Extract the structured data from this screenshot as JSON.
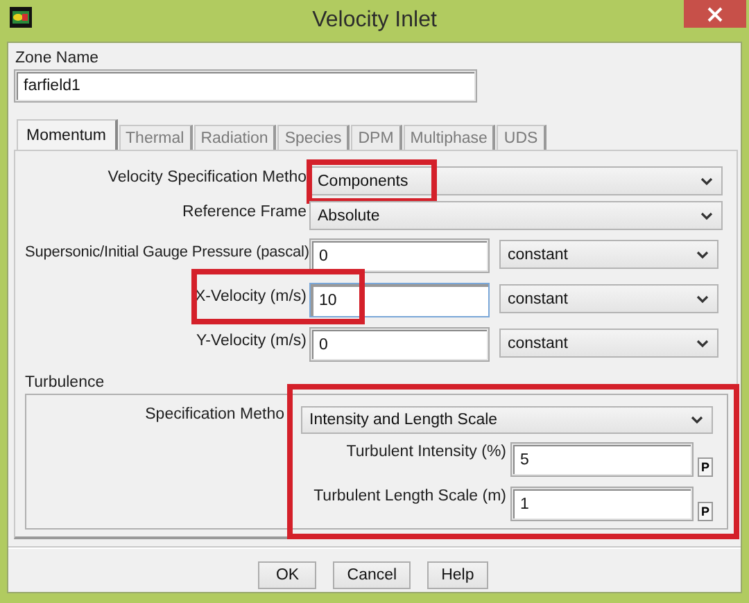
{
  "window": {
    "title": "Velocity Inlet"
  },
  "zone_name": {
    "label": "Zone Name",
    "value": "farfield1"
  },
  "tabs": [
    {
      "label": "Momentum",
      "selected": true
    },
    {
      "label": "Thermal",
      "selected": false
    },
    {
      "label": "Radiation",
      "selected": false
    },
    {
      "label": "Species",
      "selected": false
    },
    {
      "label": "DPM",
      "selected": false
    },
    {
      "label": "Multiphase",
      "selected": false
    },
    {
      "label": "UDS",
      "selected": false
    }
  ],
  "momentum": {
    "rows": [
      {
        "kind": "combo",
        "label": "Velocity Specification Metho",
        "value": "Components",
        "highlighted": true
      },
      {
        "kind": "combo",
        "label": "Reference Frame",
        "value": "Absolute",
        "highlighted": false
      },
      {
        "kind": "input",
        "label": "Supersonic/Initial Gauge Pressure (pascal)",
        "value": "0",
        "profile": "constant",
        "focused": false,
        "highlighted": false
      },
      {
        "kind": "input",
        "label": "X-Velocity (m/s)",
        "value": "10",
        "profile": "constant",
        "focused": true,
        "highlighted": true
      },
      {
        "kind": "input",
        "label": "Y-Velocity (m/s)",
        "value": "0",
        "profile": "constant",
        "focused": false,
        "highlighted": false
      }
    ]
  },
  "turbulence": {
    "title": "Turbulence",
    "method_label": "Specification Metho",
    "method": "Intensity and Length Scale",
    "highlighted": true,
    "params": [
      {
        "label": "Turbulent Intensity (%)",
        "value": "5",
        "button": "P"
      },
      {
        "label": "Turbulent Length Scale (m)",
        "value": "1",
        "button": "P"
      }
    ]
  },
  "buttons": [
    "OK",
    "Cancel",
    "Help"
  ]
}
